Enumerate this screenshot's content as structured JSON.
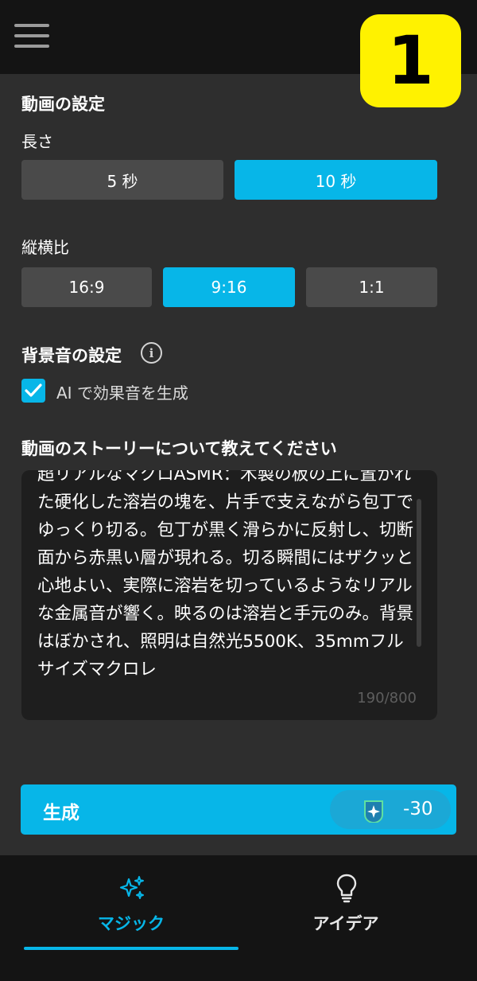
{
  "header": {
    "step_badge": "1"
  },
  "video_settings": {
    "title": "動画の設定",
    "duration": {
      "label": "長さ",
      "options": [
        "5 秒",
        "10 秒"
      ],
      "selected": "10 秒"
    },
    "aspect_ratio": {
      "label": "縦横比",
      "options": [
        "16:9",
        "9:16",
        "1:1"
      ],
      "selected": "9:16"
    }
  },
  "sound_settings": {
    "title": "背景音の設定",
    "info_icon": "info-icon",
    "ai_sfx": {
      "label": "AI で効果音を生成",
      "checked": true
    }
  },
  "story": {
    "title": "動画のストーリーについて教えてください",
    "text": "超リアルなマクロASMR：木製の板の上に置かれた硬化した溶岩の塊を、片手で支えながら包丁でゆっくり切る。包丁が黒く滑らかに反射し、切断面から赤黒い層が現れる。切る瞬間にはザクッと心地よい、実際に溶岩を切っているようなリアルな金属音が響く。映るのは溶岩と手元のみ。背景はぼかされ、照明は自然光5500K、35mmフルサイズマクロレ",
    "counter": "190/800"
  },
  "generate": {
    "label": "生成",
    "credit": "-30",
    "credit_icon": "sparkle-credit-icon"
  },
  "bottom_nav": {
    "items": [
      {
        "label": "マジック",
        "icon": "sparkles-icon",
        "active": true
      },
      {
        "label": "アイデア",
        "icon": "lightbulb-icon",
        "active": false
      }
    ]
  },
  "colors": {
    "accent": "#07b6e8",
    "background": "#2e2e2e",
    "bar": "#141414",
    "badge": "#fff200"
  }
}
